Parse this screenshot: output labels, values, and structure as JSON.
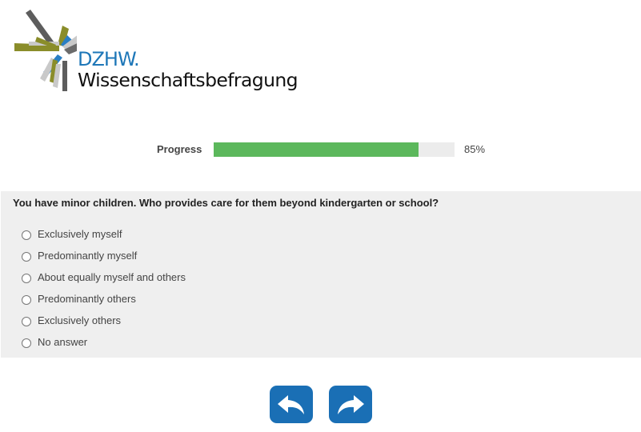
{
  "logo": {
    "acronym": "DZHW.",
    "name": "Wissenschaftsbefragung"
  },
  "progress": {
    "label": "Progress",
    "value_percent": 85,
    "value_text": "85%",
    "fill_color": "#5cb85c"
  },
  "question": {
    "text": "You have minor children. Who provides care for them beyond kindergarten or school?",
    "options": [
      "Exclusively myself",
      "Predominantly myself",
      "About equally myself and others",
      "Predominantly others",
      "Exclusively others",
      "No answer"
    ]
  },
  "navigation": {
    "back_icon": "back-arrow-icon",
    "next_icon": "forward-arrow-icon",
    "button_color": "#1a6fb5"
  }
}
